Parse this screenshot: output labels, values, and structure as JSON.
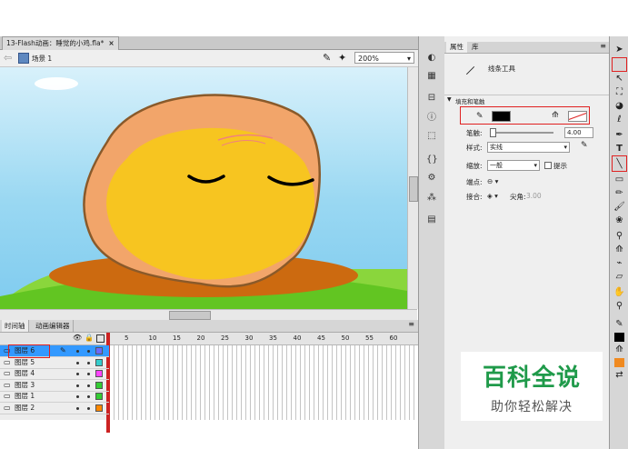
{
  "document_tab": {
    "title": "13-Flash动画：睡觉的小鸡.fla*",
    "close": "×"
  },
  "scene": {
    "label": "场景 1",
    "zoom": "200%"
  },
  "timeline": {
    "tabs": [
      "时间轴",
      "动画编辑器"
    ],
    "frame_numbers": [
      "5",
      "10",
      "15",
      "20",
      "25",
      "30",
      "35",
      "40",
      "45",
      "50",
      "55",
      "60"
    ],
    "layers": [
      {
        "name": "图层 6",
        "color": "#6a6aff",
        "selected": true
      },
      {
        "name": "图层 5",
        "color": "#33cccc"
      },
      {
        "name": "图层 4",
        "color": "#ff44ff"
      },
      {
        "name": "图层 3",
        "color": "#33cc33"
      },
      {
        "name": "图层 1",
        "color": "#33cc33"
      },
      {
        "name": "图层 2",
        "color": "#ff8800"
      }
    ]
  },
  "properties": {
    "tabs": [
      "属性",
      "库"
    ],
    "tool_name": "线条工具",
    "section_fill_stroke": "填充和笔触",
    "stroke_label": "笔触:",
    "stroke_value": "4.00",
    "style_label": "样式:",
    "style_value": "实线",
    "scale_label": "缩放:",
    "scale_value": "一般",
    "hint_label": "提示",
    "cap_label": "端点:",
    "join_label": "接合:",
    "miter_label": "尖角:",
    "miter_value": "3.00",
    "stroke_color": "#000000",
    "fill_color": "#ffffff"
  },
  "watermark": {
    "title": "百科全说",
    "subtitle": "助你轻松解决"
  },
  "colors": {
    "accent_red": "#e02020",
    "selected_layer": "#3399ff",
    "egg_yellow": "#f7c520",
    "ground": "#cc6a10"
  }
}
